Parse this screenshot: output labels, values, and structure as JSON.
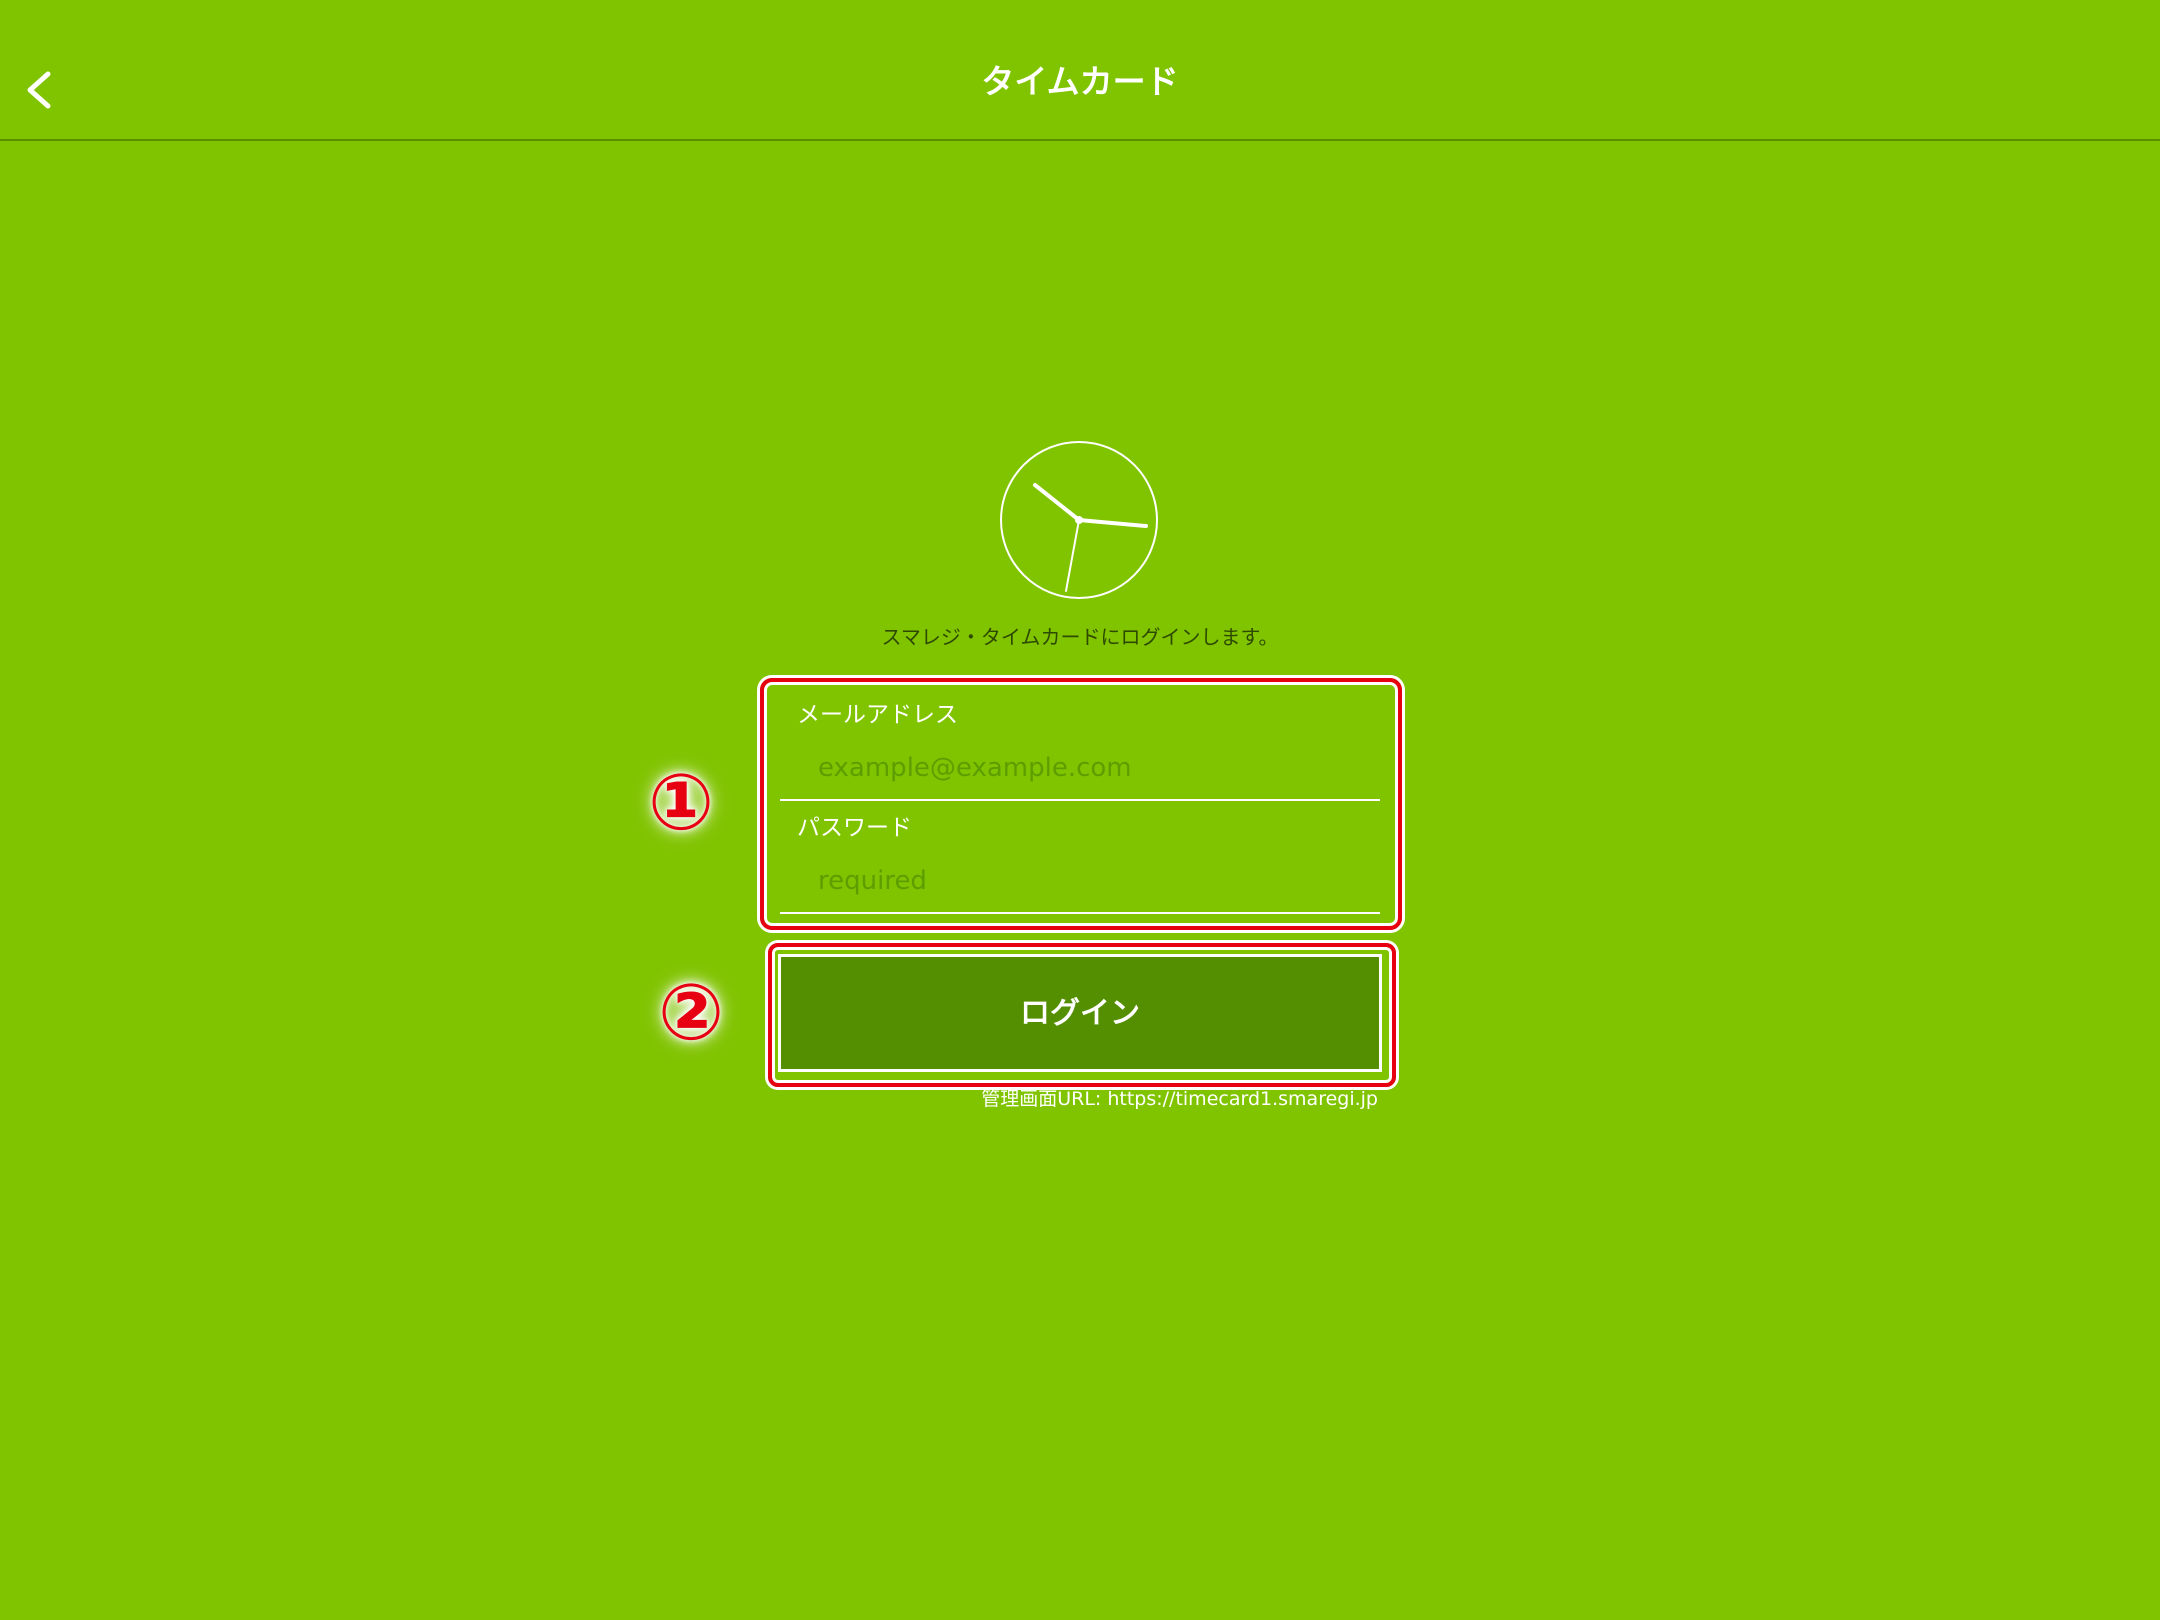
{
  "header": {
    "title": "タイムカード",
    "back_icon": "chevron-left-icon"
  },
  "intro": {
    "icon": "clock-icon",
    "message": "スマレジ・タイムカードにログインします。"
  },
  "form": {
    "email": {
      "label": "メールアドレス",
      "placeholder": "example@example.com",
      "value": ""
    },
    "password": {
      "label": "パスワード",
      "placeholder": "required",
      "value": ""
    }
  },
  "login": {
    "label": "ログイン"
  },
  "footer": {
    "admin_url": "管理画面URL: https://timecard1.smaregi.jp"
  },
  "annotations": {
    "step1": "①",
    "step2": "②"
  },
  "colors": {
    "background": "#80c400",
    "button": "#538f00",
    "annotation": "#e60012"
  }
}
